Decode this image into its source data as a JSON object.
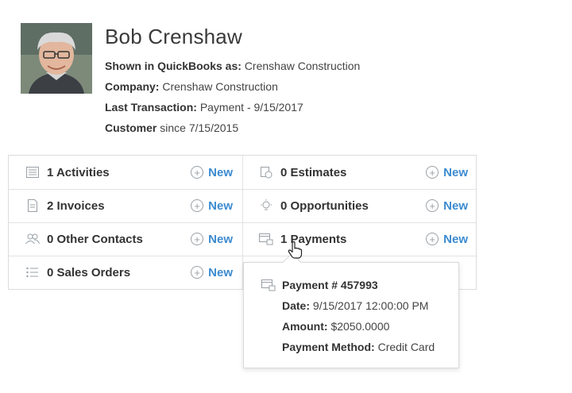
{
  "customer": {
    "name": "Bob Crenshaw",
    "shown_label": "Shown in QuickBooks as:",
    "shown_value": "Crenshaw Construction",
    "company_label": "Company:",
    "company_value": "Crenshaw Construction",
    "last_tx_label": "Last Transaction:",
    "last_tx_value": "Payment - 9/15/2017",
    "since_label": "Customer",
    "since_value": "since 7/15/2015"
  },
  "tiles": {
    "new_label": "New",
    "activities": {
      "label": "1 Activities",
      "icon": "list-icon"
    },
    "estimates": {
      "label": "0 Estimates",
      "icon": "estimate-icon"
    },
    "invoices": {
      "label": "2 Invoices",
      "icon": "invoice-icon"
    },
    "opportunities": {
      "label": "0 Opportunities",
      "icon": "lightbulb-icon"
    },
    "other_contacts": {
      "label": "0 Other Contacts",
      "icon": "contacts-icon"
    },
    "payments": {
      "label": "1 Payments",
      "icon": "payment-icon"
    },
    "sales_orders": {
      "label": "0 Sales Orders",
      "icon": "bullet-list-icon"
    }
  },
  "popup": {
    "title": "Payment # 457993",
    "date_label": "Date:",
    "date_value": "9/15/2017 12:00:00 PM",
    "amount_label": "Amount:",
    "amount_value": "$2050.0000",
    "method_label": "Payment Method:",
    "method_value": "Credit Card"
  },
  "colors": {
    "accent": "#3b8bd0",
    "border": "#dcdcdc",
    "icon": "#9aa0a6"
  }
}
